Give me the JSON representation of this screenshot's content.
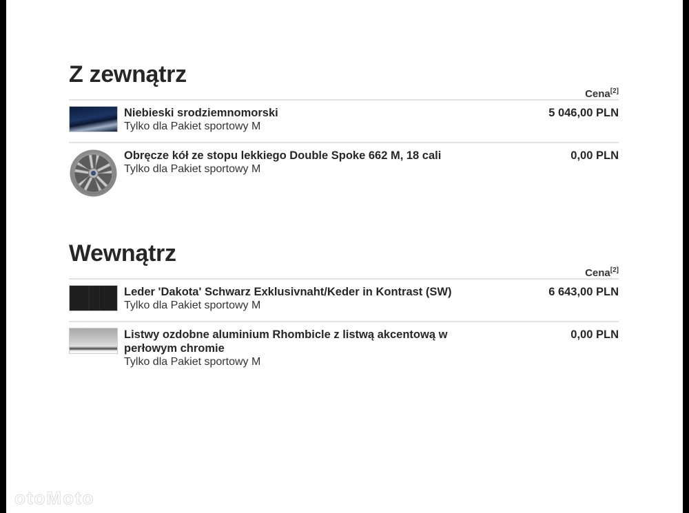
{
  "price_header_label": "Cena",
  "price_header_footnote": "[2]",
  "sections": [
    {
      "title": "Z zewnątrz",
      "items": [
        {
          "name": "Niebieski srodziemnomorski",
          "note": "Tylko dla Pakiet sportowy M",
          "price": "5 046,00 PLN",
          "thumbnail": "blue-paint-swatch"
        },
        {
          "name": "Obręcze kół ze stopu lekkiego Double Spoke 662 M, 18 cali",
          "note": "Tylko dla Pakiet sportowy M",
          "price": "0,00 PLN",
          "thumbnail": "alloy-wheel"
        }
      ]
    },
    {
      "title": "Wewnątrz",
      "items": [
        {
          "name": "Leder 'Dakota' Schwarz Exklusivnaht/Keder in Kontrast (SW)",
          "note": "Tylko dla Pakiet sportowy M",
          "price": "6 643,00 PLN",
          "thumbnail": "black-leather-swatch"
        },
        {
          "name": "Listwy ozdobne aluminium Rhombicle z listwą akcentową w perłowym chromie",
          "note": "Tylko dla Pakiet sportowy M",
          "price": "0,00 PLN",
          "thumbnail": "aluminium-trim-swatch"
        }
      ]
    }
  ],
  "watermark": "otoMoto"
}
